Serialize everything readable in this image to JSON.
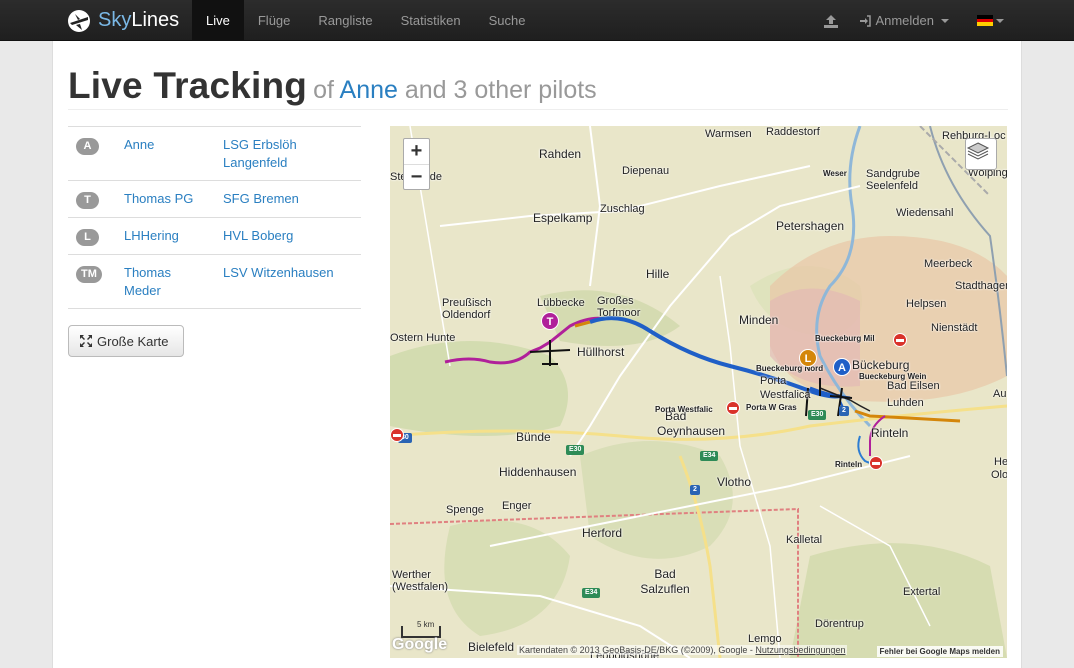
{
  "brand": {
    "sky": "Sky",
    "lines": "Lines"
  },
  "nav": {
    "items": [
      {
        "label": "Live",
        "active": true
      },
      {
        "label": "Flüge",
        "active": false
      },
      {
        "label": "Rangliste",
        "active": false
      },
      {
        "label": "Statistiken",
        "active": false
      },
      {
        "label": "Suche",
        "active": false
      }
    ],
    "upload_icon": "upload-icon",
    "login_label": "Anmelden",
    "language_icon": "flag-de-icon"
  },
  "heading": {
    "title": "Live Tracking",
    "of": "of",
    "pilot": "Anne",
    "rest": "and 3 other pilots"
  },
  "pilots": [
    {
      "badge": "A",
      "name": "Anne",
      "club": "LSG Erbslöh Langenfeld"
    },
    {
      "badge": "T",
      "name": "Thomas PG",
      "club": "SFG Bremen"
    },
    {
      "badge": "L",
      "name": "LHHering",
      "club": "HVL Boberg"
    },
    {
      "badge": "TM",
      "name": "Thomas Meder",
      "club": "LSV Witzenhausen"
    }
  ],
  "big_map_button": "Große Karte",
  "map": {
    "zoom_in": "+",
    "zoom_out": "−",
    "places": [
      "Rahden",
      "Warmsen",
      "Raddestorf",
      "Rehburg-Loc",
      "Stemwede",
      "Diepenau",
      "Weser",
      "Sandgrube Seelenfeld",
      "Wölping",
      "Zuschlag",
      "Espelkamp",
      "Petershagen",
      "Wiedensahl",
      "Hille",
      "Meerbeck",
      "Preußisch Oldendorf",
      "Lübbecke",
      "Großes Torfmoor",
      "Minden",
      "Helpsen",
      "Stadthagen",
      "Nienstädt",
      "Bueckeburg Mil",
      "Bückeburg",
      "Bueckeburg Nord",
      "Bueckeburg Wein",
      "Bad Eilsen",
      "Porta Westfalica",
      "Porta W Gras",
      "Luhden",
      "Hüllhorst",
      "Bünde",
      "Oeynhausen",
      "Rinteln",
      "Hiddenhausen",
      "Vlotho",
      "Spenge",
      "Enger",
      "Herford",
      "Kalletal",
      "Werther (Westfalen)",
      "Bad Salzuflen",
      "Extertal",
      "Dörentrup",
      "Bielefeld",
      "Lemgo",
      "Leopoldshöhe",
      "Au",
      "He",
      "Olo",
      "Bad",
      "Rinteln",
      "Porta Westfalic",
      "Ostern Hunte"
    ],
    "roads": [
      "30",
      "E30",
      "E34",
      "2",
      "E30",
      "2",
      "E34"
    ],
    "pilot_markers": [
      "T",
      "L",
      "A"
    ],
    "scale": "5 km",
    "attribution": "Kartendaten © 2013 GeoBasis-DE/BKG (©2009), Google -",
    "terms": "Nutzungsbedingungen",
    "report": "Fehler bei Google Maps melden",
    "google": "Google",
    "colors": {
      "track_A": "#1f5fc7",
      "track_T": "#b0209a",
      "track_L": "#d4860a",
      "track_TM": "#2d7dd2"
    }
  }
}
